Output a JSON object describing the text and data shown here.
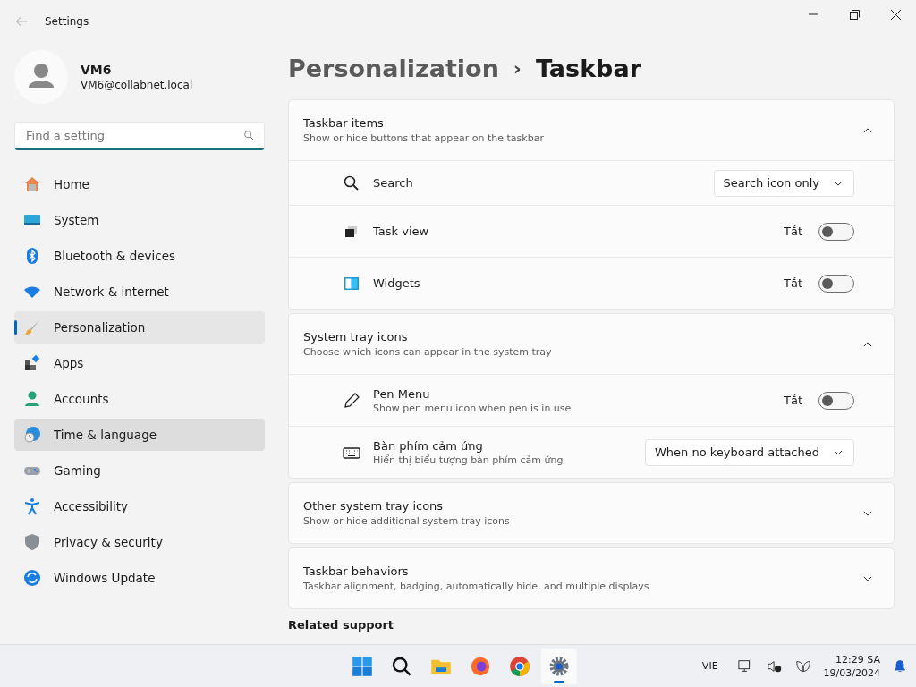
{
  "window": {
    "title": "Settings",
    "back_disabled": true
  },
  "account": {
    "name": "VM6",
    "email": "VM6@collabnet.local"
  },
  "search": {
    "placeholder": "Find a setting"
  },
  "sidebar": {
    "items": [
      {
        "label": "Home",
        "selected": false,
        "hovered": false
      },
      {
        "label": "System",
        "selected": false,
        "hovered": false
      },
      {
        "label": "Bluetooth & devices",
        "selected": false,
        "hovered": false
      },
      {
        "label": "Network & internet",
        "selected": false,
        "hovered": false
      },
      {
        "label": "Personalization",
        "selected": true,
        "hovered": false
      },
      {
        "label": "Apps",
        "selected": false,
        "hovered": false
      },
      {
        "label": "Accounts",
        "selected": false,
        "hovered": false
      },
      {
        "label": "Time & language",
        "selected": false,
        "hovered": true
      },
      {
        "label": "Gaming",
        "selected": false,
        "hovered": false
      },
      {
        "label": "Accessibility",
        "selected": false,
        "hovered": false
      },
      {
        "label": "Privacy & security",
        "selected": false,
        "hovered": false
      },
      {
        "label": "Windows Update",
        "selected": false,
        "hovered": false
      }
    ]
  },
  "breadcrumb": {
    "parent": "Personalization",
    "separator": "›",
    "current": "Taskbar"
  },
  "sections": [
    {
      "title": "Taskbar items",
      "subtitle": "Show or hide buttons that appear on the taskbar",
      "expanded": true,
      "rows": [
        {
          "kind": "dropdown",
          "label": "Search",
          "value": "Search icon only"
        },
        {
          "kind": "toggle",
          "label": "Task view",
          "state_text": "Tắt",
          "on": false
        },
        {
          "kind": "toggle",
          "label": "Widgets",
          "state_text": "Tắt",
          "on": false
        }
      ]
    },
    {
      "title": "System tray icons",
      "subtitle": "Choose which icons can appear in the system tray",
      "expanded": true,
      "rows": [
        {
          "kind": "toggle",
          "label": "Pen Menu",
          "description": "Show pen menu icon when pen is in use",
          "state_text": "Tắt",
          "on": false
        },
        {
          "kind": "dropdown",
          "label": "Bàn phím cảm ứng",
          "description": "Hiển thị biểu tượng bàn phím cảm ứng",
          "value": "When no keyboard attached"
        }
      ]
    },
    {
      "title": "Other system tray icons",
      "subtitle": "Show or hide additional system tray icons",
      "expanded": false
    },
    {
      "title": "Taskbar behaviors",
      "subtitle": "Taskbar alignment, badging, automatically hide, and multiple displays",
      "expanded": false
    }
  ],
  "related": {
    "title": "Related support"
  },
  "taskbar": {
    "apps": [
      {
        "selected": false
      },
      {
        "selected": false
      },
      {
        "selected": false
      },
      {
        "selected": false
      },
      {
        "selected": false
      },
      {
        "selected": true
      }
    ],
    "language": "VIE",
    "time": "12:29 SA",
    "date": "19/03/2024"
  }
}
